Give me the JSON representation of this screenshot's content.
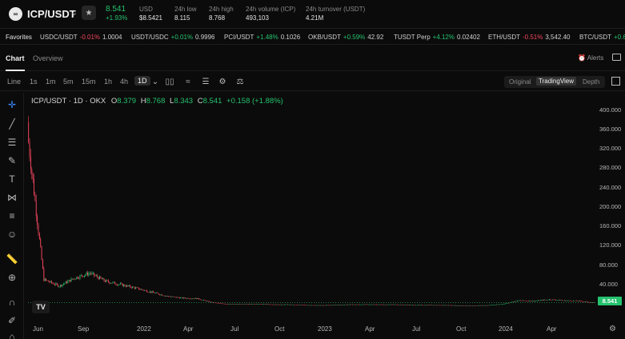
{
  "header": {
    "pair": "ICP/USDT",
    "logo_icon": "icp-logo-icon",
    "price": "8.541",
    "change_pct": "+1.93%",
    "usd_label": "USD",
    "usd_value": "$8.5421",
    "low_label": "24h low",
    "low_value": "8.115",
    "high_label": "24h high",
    "high_value": "8.768",
    "vol_label": "24h volume (ICP)",
    "vol_value": "493,103",
    "turnover_label": "24h turnover (USDT)",
    "turnover_value": "4.21M"
  },
  "favorites": {
    "label": "Favorites",
    "items": [
      {
        "name": "USDC/USDT",
        "change": "-0.01%",
        "price": "1.0004",
        "dir": "down"
      },
      {
        "name": "USDT/USDC",
        "change": "+0.01%",
        "price": "0.9996",
        "dir": "up"
      },
      {
        "name": "PCI/USDT",
        "change": "+1.48%",
        "price": "0.1026",
        "dir": "up"
      },
      {
        "name": "OKB/USDT",
        "change": "+0.59%",
        "price": "42.92",
        "dir": "up"
      },
      {
        "name": "TUSDT Perp",
        "change": "+4.12%",
        "price": "0.02402",
        "dir": "up"
      },
      {
        "name": "ETH/USDT",
        "change": "-0.51%",
        "price": "3,542.40",
        "dir": "down"
      },
      {
        "name": "BTC/USDT",
        "change": "+0.6",
        "price": "",
        "dir": "up"
      }
    ]
  },
  "tabs": {
    "chart": "Chart",
    "overview": "Overview",
    "alerts": "Alerts"
  },
  "toolbar": {
    "timeframes": [
      "Line",
      "1s",
      "1m",
      "5m",
      "15m",
      "1h",
      "4h",
      "1D"
    ],
    "active_timeframe": "1D",
    "views": [
      "Original",
      "TradingView",
      "Depth"
    ],
    "active_view": "TradingView"
  },
  "legend": {
    "title": "ICP/USDT · 1D · OKX",
    "o_label": "O",
    "o_value": "8.379",
    "h_label": "H",
    "h_value": "8.768",
    "l_label": "L",
    "l_value": "8.343",
    "c_label": "C",
    "c_value": "8.541",
    "change": "+0.158 (+1.88%)"
  },
  "colors": {
    "up": "#25c26e",
    "down": "#f0455c",
    "background": "#0b0b0b"
  },
  "chart_data": {
    "type": "candlestick",
    "y_ticks": [
      "400.000",
      "360.000",
      "320.000",
      "280.000",
      "240.000",
      "200.000",
      "160.000",
      "120.000",
      "80.000",
      "40.000"
    ],
    "x_ticks": [
      "Jun",
      "Sep",
      "2022",
      "Apr",
      "Jul",
      "Oct",
      "2023",
      "Apr",
      "Jul",
      "Oct",
      "2024",
      "Apr"
    ],
    "ylim": [
      0,
      410
    ],
    "last_price": "8.541",
    "x": [
      "2021-05",
      "2021-06",
      "2021-07",
      "2021-08",
      "2021-09",
      "2021-10",
      "2021-11",
      "2021-12",
      "2022-01",
      "2022-02",
      "2022-03",
      "2022-04",
      "2022-05",
      "2022-06",
      "2022-07",
      "2022-08",
      "2022-09",
      "2022-10",
      "2022-11",
      "2022-12",
      "2023-01",
      "2023-02",
      "2023-03",
      "2023-04",
      "2023-05",
      "2023-06",
      "2023-07",
      "2023-08",
      "2023-09",
      "2023-10",
      "2023-11",
      "2023-12",
      "2024-01",
      "2024-02",
      "2024-03",
      "2024-04",
      "2024-05",
      "2024-06"
    ],
    "series": [
      {
        "values": [
          330,
          55,
          42,
          58,
          68,
          52,
          45,
          38,
          30,
          22,
          18,
          17,
          9,
          6,
          6,
          6,
          5,
          5,
          4,
          3.5,
          4,
          5,
          5,
          5,
          5,
          4,
          4,
          3.8,
          3.2,
          3,
          3.5,
          6,
          13,
          12,
          15,
          13,
          12,
          8.5
        ]
      }
    ]
  }
}
